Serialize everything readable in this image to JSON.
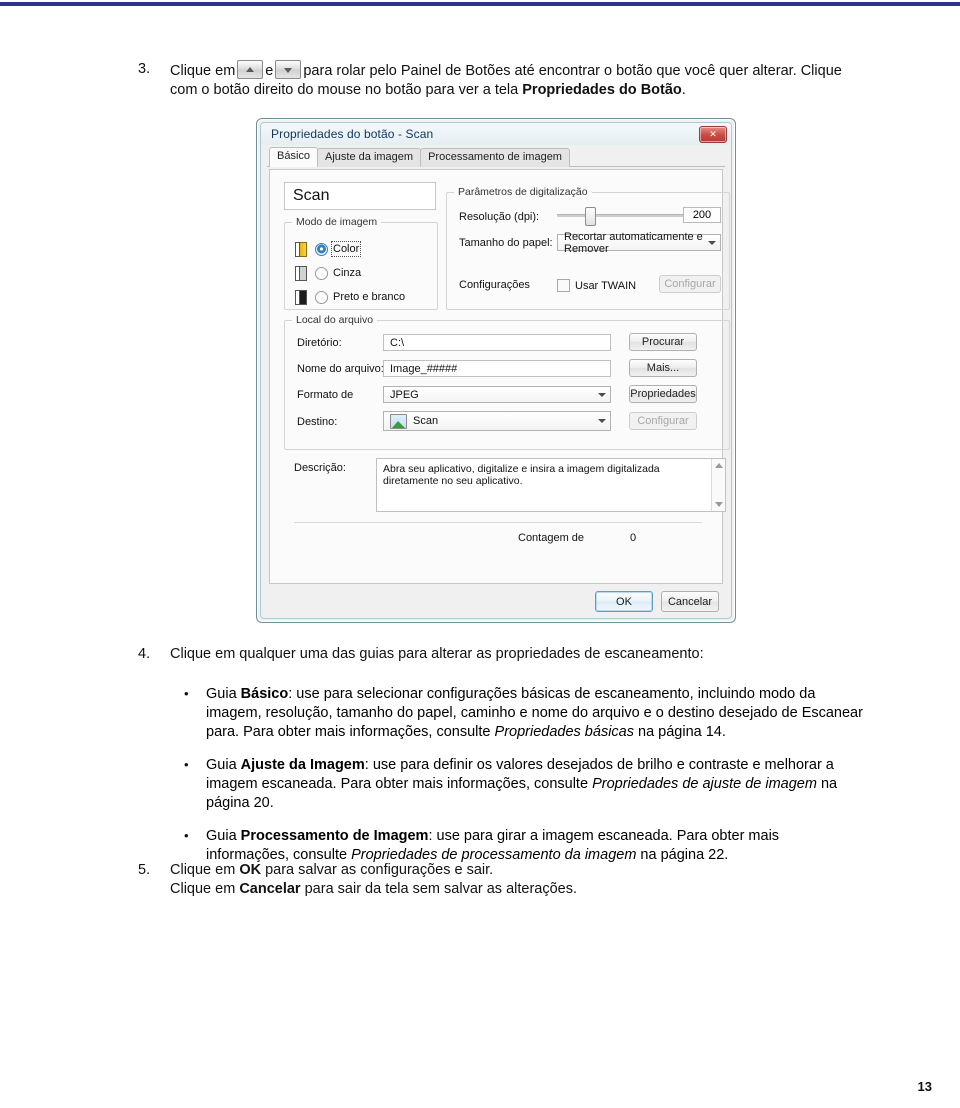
{
  "page": {
    "number": "13",
    "top_rule_color": "#2a3390"
  },
  "steps": {
    "step3": {
      "number": "3.",
      "text_a": "Clique em",
      "icon_up": "scroll-up-button-icon",
      "text_b": "e",
      "icon_down": "scroll-down-button-icon",
      "text_c": "para rolar pelo Painel de Botões até encontrar o botão que você quer alterar. Clique com o botão direito do mouse no botão para ver a tela ",
      "bold_tail": "Propriedades do Botão",
      "text_d": "."
    },
    "step4": {
      "number": "4.",
      "text": "Clique em qualquer uma das guias para alterar as propriedades de escaneamento:"
    },
    "step5": {
      "number": "5.",
      "line1_a": "Clique em ",
      "line1_bold": "OK",
      "line1_b": " para salvar as configurações e sair.",
      "line2_a": "Clique em ",
      "line2_bold": "Cancelar",
      "line2_b": " para sair da tela sem salvar as alterações."
    }
  },
  "bullets": [
    {
      "lead": "Guia ",
      "bold": "Básico",
      "text_a": ": use para selecionar configurações básicas de escaneamento, incluindo modo da imagem, resolução, tamanho do papel, caminho e nome do arquivo e o destino desejado de Escanear para. Para obter mais informações, consulte ",
      "italic": "Propriedades básicas",
      "text_b": " na página 14."
    },
    {
      "lead": "Guia ",
      "bold": "Ajuste da Imagem",
      "text_a": ": use para definir os valores desejados de brilho e contraste e melhorar a imagem escaneada. Para obter mais informações, consulte ",
      "italic": "Propriedades de ajuste de imagem",
      "text_b": " na página 20."
    },
    {
      "lead": "Guia ",
      "bold": "Processamento de Imagem",
      "text_a": ": use para girar a imagem escaneada. Para obter mais informações, consulte ",
      "italic": "Propriedades de processamento da imagem",
      "text_b": " na página 22."
    }
  ],
  "dialog": {
    "title": "Propriedades do botão - Scan",
    "close_glyph": "✕",
    "tabs": [
      {
        "label": "Básico",
        "active": true
      },
      {
        "label": "Ajuste da imagem",
        "active": false
      },
      {
        "label": "Processamento de imagem",
        "active": false
      }
    ],
    "button_name": "Scan",
    "image_mode": {
      "legend": "Modo de imagem",
      "options": [
        {
          "label": "Color",
          "selected": true
        },
        {
          "label": "Cinza",
          "selected": false
        },
        {
          "label": "Preto e branco",
          "selected": false
        }
      ]
    },
    "scan_params": {
      "legend": "Parâmetros de digitalização",
      "resolution_label": "Resolução (dpi):",
      "resolution_value": "200",
      "paper_label": "Tamanho do papel:",
      "paper_value": "Recortar automaticamente e Remover",
      "settings_label": "Configurações",
      "twain_label": "Usar TWAIN",
      "twain_checked": false,
      "configure_button": "Configurar"
    },
    "file_location": {
      "legend": "Local do arquivo",
      "dir_label": "Diretório:",
      "dir_value": "C:\\",
      "dir_button": "Procurar",
      "name_label": "Nome do arquivo:",
      "name_value": "Image_#####",
      "name_button": "Mais...",
      "format_label": "Formato de",
      "format_value": "JPEG",
      "format_button": "Propriedades",
      "dest_label": "Destino:",
      "dest_value": "Scan",
      "dest_icon": "picture-icon",
      "dest_button": "Configurar"
    },
    "description": {
      "label": "Descrição:",
      "value": "Abra seu aplicativo, digitalize e insira a imagem digitalizada diretamente no seu aplicativo."
    },
    "count_label": "Contagem de",
    "count_value": "0",
    "ok_button": "OK",
    "cancel_button": "Cancelar"
  }
}
